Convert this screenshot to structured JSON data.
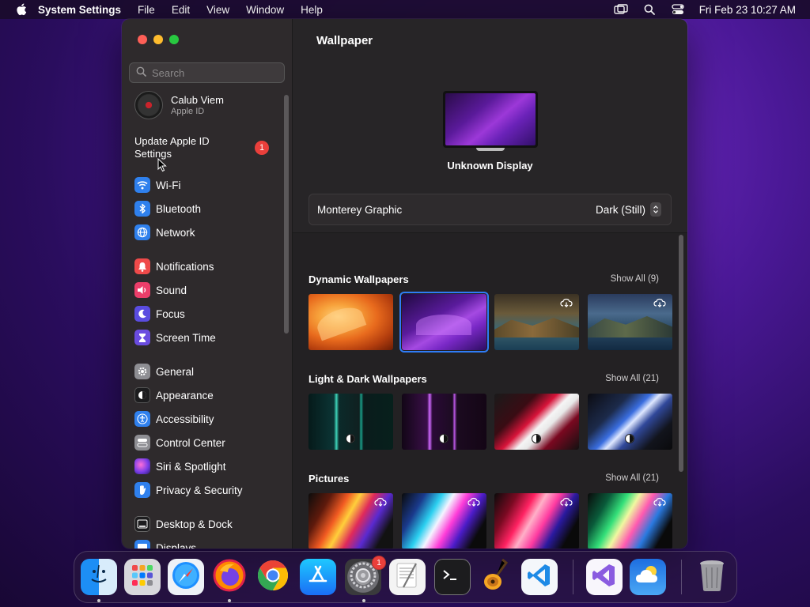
{
  "menubar": {
    "app_name": "System Settings",
    "menus": [
      "File",
      "Edit",
      "View",
      "Window",
      "Help"
    ],
    "clock": "Fri Feb 23  10:27 AM"
  },
  "sidebar": {
    "search_placeholder": "Search",
    "account": {
      "name": "Calub Viem",
      "subtitle": "Apple ID"
    },
    "update": {
      "label": "Update Apple ID Settings",
      "badge": "1"
    },
    "items": [
      {
        "label": "Wi-Fi",
        "icon": "wifi-icon",
        "color": "#2f80ed"
      },
      {
        "label": "Bluetooth",
        "icon": "bluetooth-icon",
        "color": "#2f80ed"
      },
      {
        "label": "Network",
        "icon": "globe-icon",
        "color": "#2f80ed"
      },
      {
        "label": "Notifications",
        "icon": "bell-icon",
        "color": "#ef4a4a"
      },
      {
        "label": "Sound",
        "icon": "speaker-icon",
        "color": "#ec3e6a"
      },
      {
        "label": "Focus",
        "icon": "moon-icon",
        "color": "#5a4ce0"
      },
      {
        "label": "Screen Time",
        "icon": "hourglass-icon",
        "color": "#6a4ce0"
      },
      {
        "label": "General",
        "icon": "gear-icon",
        "color": "#8e8e93"
      },
      {
        "label": "Appearance",
        "icon": "appearance-icon",
        "color": "#1c1c1e"
      },
      {
        "label": "Accessibility",
        "icon": "accessibility-icon",
        "color": "#2f80ed"
      },
      {
        "label": "Control Center",
        "icon": "control-center-icon",
        "color": "#8e8e93"
      },
      {
        "label": "Siri & Spotlight",
        "icon": "siri-icon",
        "color": "#c03ad0"
      },
      {
        "label": "Privacy & Security",
        "icon": "hand-icon",
        "color": "#2f80ed"
      },
      {
        "label": "Desktop & Dock",
        "icon": "dock-icon",
        "color": "#1c1c1e"
      },
      {
        "label": "Displays",
        "icon": "display-icon",
        "color": "#2f80ed"
      }
    ]
  },
  "main": {
    "title": "Wallpaper",
    "display_name": "Unknown Display",
    "current_wallpaper": "Monterey Graphic",
    "appearance_mode": "Dark (Still)",
    "sections": [
      {
        "title": "Dynamic Wallpapers",
        "show_all": "Show All (9)"
      },
      {
        "title": "Light & Dark Wallpapers",
        "show_all": "Show All (21)"
      },
      {
        "title": "Pictures",
        "show_all": "Show All (21)"
      }
    ]
  },
  "dock": {
    "apps": [
      {
        "name": "Finder",
        "icon": "finder-icon"
      },
      {
        "name": "Launchpad",
        "icon": "launchpad-icon"
      },
      {
        "name": "Safari",
        "icon": "safari-icon"
      },
      {
        "name": "Firefox",
        "icon": "firefox-icon"
      },
      {
        "name": "Chrome",
        "icon": "chrome-icon"
      },
      {
        "name": "App Store",
        "icon": "app-store-icon"
      },
      {
        "name": "System Settings",
        "icon": "system-settings-icon",
        "badge": "1"
      },
      {
        "name": "TextEdit",
        "icon": "textedit-icon"
      },
      {
        "name": "Terminal",
        "icon": "terminal-icon"
      },
      {
        "name": "GarageBand",
        "icon": "garageband-icon"
      },
      {
        "name": "Visual Studio Code",
        "icon": "vscode-icon"
      },
      {
        "name": "Visual Studio",
        "icon": "visual-studio-icon"
      },
      {
        "name": "Weather",
        "icon": "weather-icon"
      },
      {
        "name": "Trash",
        "icon": "trash-icon"
      }
    ]
  }
}
